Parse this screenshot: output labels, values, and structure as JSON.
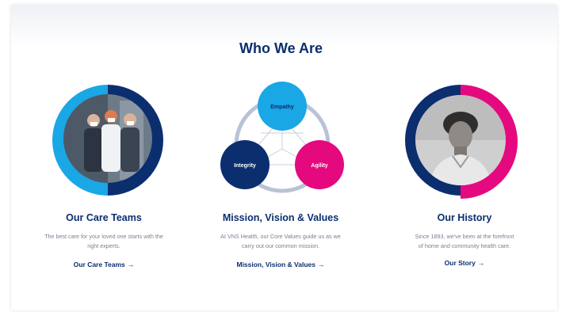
{
  "section_title": "Who We Are",
  "colors": {
    "navy": "#0b2e6f",
    "cyan": "#1aa7e6",
    "magenta": "#e5097f",
    "ring_gray": "#b9c2d6"
  },
  "columns": [
    {
      "heading": "Our Care Teams",
      "description_lines": [
        "The best care for your loved one starts with the",
        "right experts."
      ],
      "link_label": "Our Care Teams",
      "link_arrow": "→",
      "image": "care-team-photo"
    },
    {
      "heading": "Mission, Vision & Values",
      "description_lines": [
        "At VNS Health, our Core Values guide us as we",
        "carry out our common mission."
      ],
      "link_label": "Mission, Vision & Values",
      "link_arrow": "→",
      "values": [
        "Empathy",
        "Integrity",
        "Agility"
      ]
    },
    {
      "heading": "Our History",
      "description_lines": [
        "Since 1893, we've been at the forefront",
        "of home and community health care."
      ],
      "link_label": "Our Story",
      "link_arrow": "→",
      "image": "historic-nurse-portrait"
    }
  ]
}
